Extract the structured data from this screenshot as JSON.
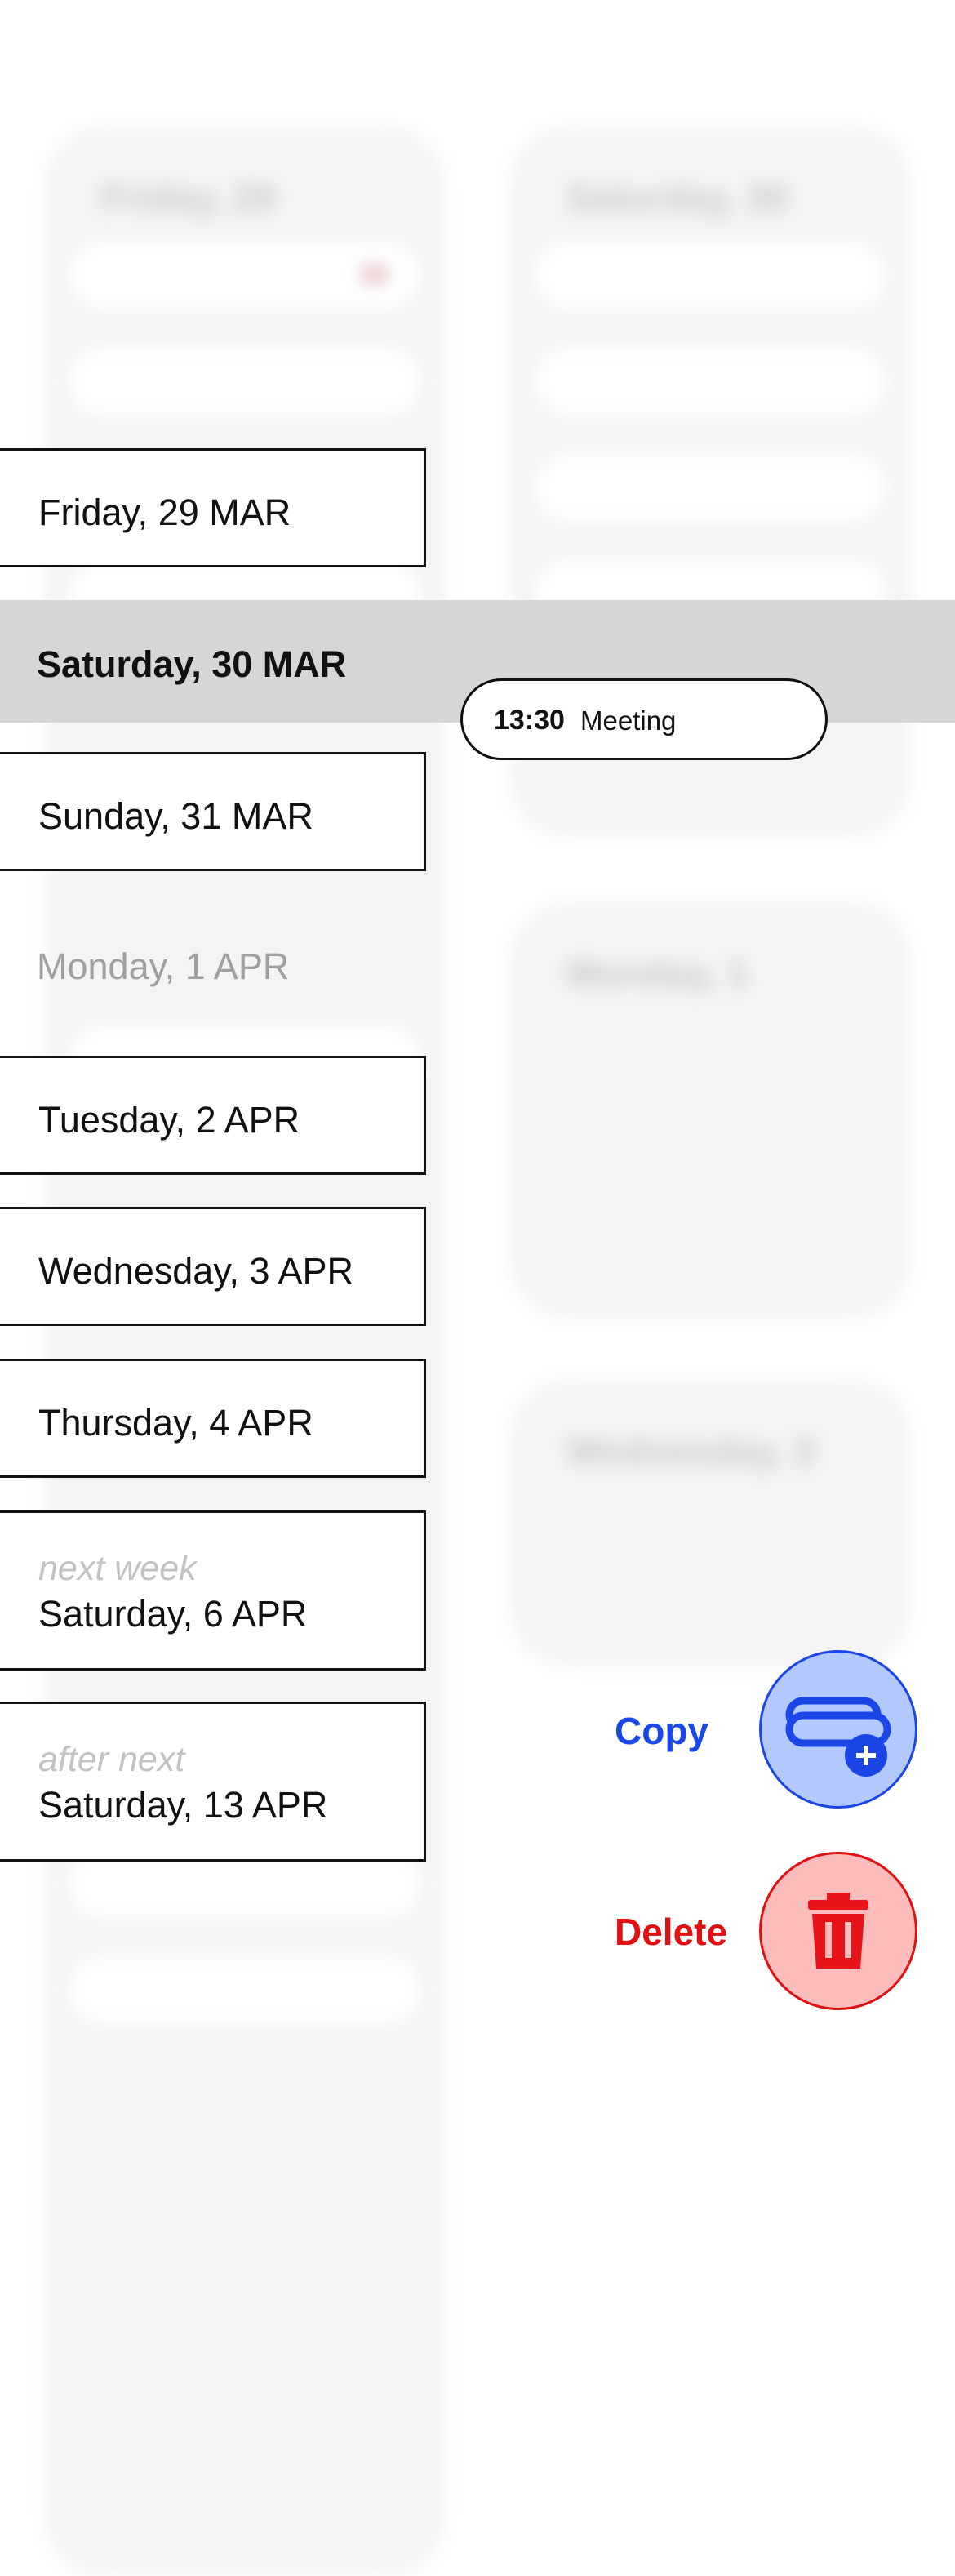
{
  "background": {
    "cards": [
      {
        "title": "Friday, 29"
      },
      {
        "title": "Saturday, 30"
      },
      {
        "title": "Monday, 1"
      },
      {
        "title": "Wednesday, 3"
      }
    ]
  },
  "date_options": [
    {
      "label": "Friday, 29 MAR",
      "sub": ""
    },
    {
      "label": "Saturday, 30 MAR",
      "sub": "",
      "selected": true
    },
    {
      "label": "Sunday, 31 MAR",
      "sub": ""
    },
    {
      "label": "Monday, 1 APR",
      "sub": "",
      "disabled": true
    },
    {
      "label": "Tuesday, 2 APR",
      "sub": ""
    },
    {
      "label": "Wednesday, 3 APR",
      "sub": ""
    },
    {
      "label": "Thursday, 4 APR",
      "sub": ""
    },
    {
      "label": "Saturday, 6 APR",
      "sub": "next week"
    },
    {
      "label": "Saturday, 13 APR",
      "sub": "after next"
    }
  ],
  "event": {
    "time": "13:30",
    "title": "Meeting"
  },
  "actions": {
    "copy_label": "Copy",
    "delete_label": "Delete"
  },
  "colors": {
    "copy": "#1a46e8",
    "copy_bg": "#b3c8fd",
    "delete": "#e01010",
    "delete_bg": "#fdbcbc",
    "highlight": "#d6d6d6"
  },
  "icons": {
    "copy": "event-copy-plus-icon",
    "delete": "trash-icon"
  }
}
